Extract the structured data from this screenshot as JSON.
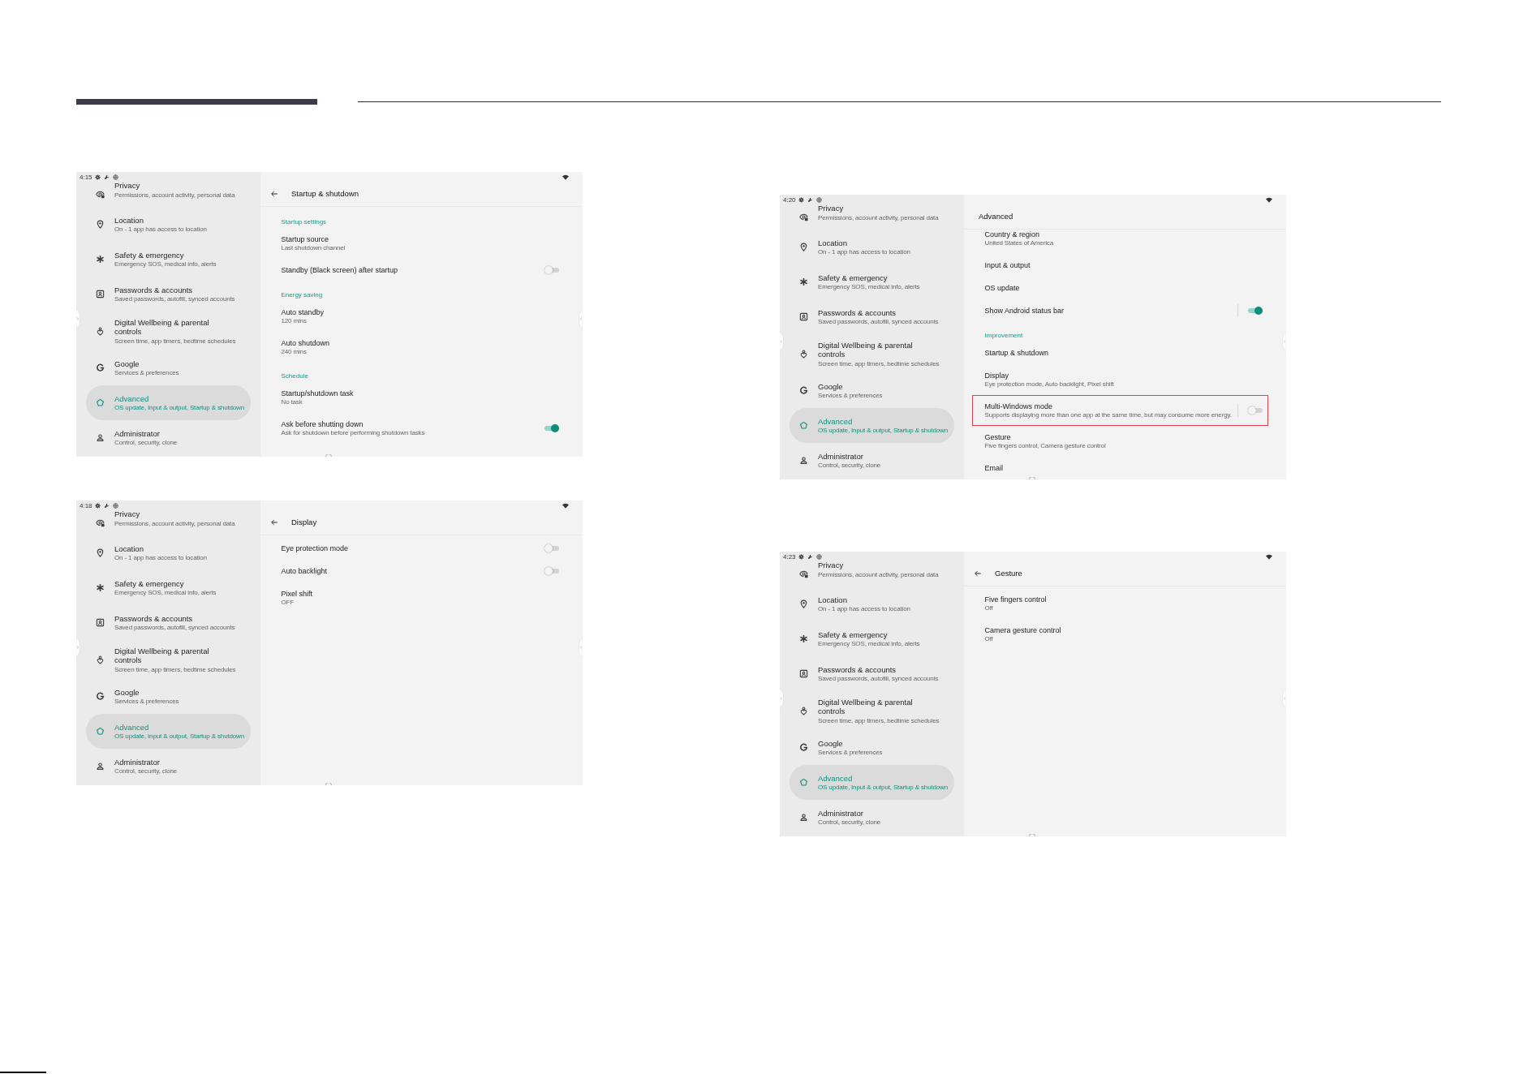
{
  "screens": [
    {
      "status_bar": {
        "time": "4:15"
      },
      "sidebar": {
        "items": [
          {
            "title": "Privacy",
            "subtitle": "Permissions, account activity, personal data",
            "selected": false
          },
          {
            "title": "Location",
            "subtitle": "On - 1 app has access to location",
            "selected": false
          },
          {
            "title": "Safety & emergency",
            "subtitle": "Emergency SOS, medical info, alerts",
            "selected": false
          },
          {
            "title": "Passwords & accounts",
            "subtitle": "Saved passwords, autofill, synced accounts",
            "selected": false
          },
          {
            "title": "Digital Wellbeing & parental controls",
            "subtitle": "Screen time, app timers, bedtime schedules",
            "selected": false
          },
          {
            "title": "Google",
            "subtitle": "Services & preferences",
            "selected": false
          },
          {
            "title": "Advanced",
            "subtitle": "OS update, Input & output, Startup & shutdown",
            "selected": true
          },
          {
            "title": "Administrator",
            "subtitle": "Control, security, clone",
            "selected": false
          }
        ]
      },
      "page": {
        "title": "Startup & shutdown",
        "back": true,
        "items": [
          {
            "kind": "section",
            "title": "Startup settings"
          },
          {
            "kind": "entry",
            "title": "Startup source",
            "subtitle": "Last shutdown channel"
          },
          {
            "kind": "switch",
            "title": "Standby (Black screen) after startup",
            "on": false
          },
          {
            "kind": "section",
            "title": "Energy saving"
          },
          {
            "kind": "entry",
            "title": "Auto standby",
            "subtitle": "120 mins"
          },
          {
            "kind": "entry",
            "title": "Auto shutdown",
            "subtitle": "240 mins"
          },
          {
            "kind": "section",
            "title": "Schedule"
          },
          {
            "kind": "entry",
            "title": "Startup/shutdown task",
            "subtitle": "No task"
          },
          {
            "kind": "switch",
            "title": "Ask before shutting down",
            "subtitle": "Ask for shutdown before performing shutdown tasks",
            "on": true
          }
        ]
      }
    },
    {
      "status_bar": {
        "time": "4:18"
      },
      "sidebar": {
        "items": [
          {
            "title": "Privacy",
            "subtitle": "Permissions, account activity, personal data",
            "selected": false
          },
          {
            "title": "Location",
            "subtitle": "On - 1 app has access to location",
            "selected": false
          },
          {
            "title": "Safety & emergency",
            "subtitle": "Emergency SOS, medical info, alerts",
            "selected": false
          },
          {
            "title": "Passwords & accounts",
            "subtitle": "Saved passwords, autofill, synced accounts",
            "selected": false
          },
          {
            "title": "Digital Wellbeing & parental controls",
            "subtitle": "Screen time, app timers, bedtime schedules",
            "selected": false
          },
          {
            "title": "Google",
            "subtitle": "Services & preferences",
            "selected": false
          },
          {
            "title": "Advanced",
            "subtitle": "OS update, Input & output, Startup & shutdown",
            "selected": true
          },
          {
            "title": "Administrator",
            "subtitle": "Control, security, clone",
            "selected": false
          }
        ]
      },
      "page": {
        "title": "Display",
        "back": true,
        "items": [
          {
            "kind": "switch",
            "title": "Eye protection mode",
            "on": false
          },
          {
            "kind": "switch",
            "title": "Auto backlight",
            "on": false
          },
          {
            "kind": "entry",
            "title": "Pixel shift",
            "subtitle": "OFF"
          }
        ]
      }
    },
    {
      "status_bar": {
        "time": "4:20"
      },
      "sidebar": {
        "items": [
          {
            "title": "Privacy",
            "subtitle": "Permissions, account activity, personal data",
            "selected": false
          },
          {
            "title": "Location",
            "subtitle": "On - 1 app has access to location",
            "selected": false
          },
          {
            "title": "Safety & emergency",
            "subtitle": "Emergency SOS, medical info, alerts",
            "selected": false
          },
          {
            "title": "Passwords & accounts",
            "subtitle": "Saved passwords, autofill, synced accounts",
            "selected": false
          },
          {
            "title": "Digital Wellbeing & parental controls",
            "subtitle": "Screen time, app timers, bedtime schedules",
            "selected": false
          },
          {
            "title": "Google",
            "subtitle": "Services & preferences",
            "selected": false
          },
          {
            "title": "Advanced",
            "subtitle": "OS update, Input & output, Startup & shutdown",
            "selected": true
          },
          {
            "title": "Administrator",
            "subtitle": "Control, security, clone",
            "selected": false
          }
        ]
      },
      "page": {
        "title": "Advanced",
        "back": false,
        "items": [
          {
            "kind": "entry",
            "title": "Country & region",
            "subtitle": "United States of America",
            "highlighted": false
          },
          {
            "kind": "entry",
            "title": "Input & output",
            "highlighted": false
          },
          {
            "kind": "entry",
            "title": "OS update",
            "highlighted": false
          },
          {
            "kind": "split",
            "title": "Show Android status bar",
            "on": true,
            "highlighted": false
          },
          {
            "kind": "section",
            "title": "Improvement",
            "highlighted": false
          },
          {
            "kind": "entry",
            "title": "Startup & shutdown",
            "highlighted": false
          },
          {
            "kind": "entry",
            "title": "Display",
            "subtitle": "Eye protection mode, Auto backlight, Pixel shift",
            "highlighted": false
          },
          {
            "kind": "split",
            "title": "Multi-Windows mode",
            "subtitle": "Supports displaying more than one app at the same time, but may consume more energy.",
            "on": false,
            "highlighted": true
          },
          {
            "kind": "entry",
            "title": "Gesture",
            "subtitle": "Five fingers control, Camera gesture control",
            "highlighted": false
          },
          {
            "kind": "entry",
            "title": "Email",
            "highlighted": false
          }
        ]
      }
    },
    {
      "status_bar": {
        "time": "4:23"
      },
      "sidebar": {
        "items": [
          {
            "title": "Privacy",
            "subtitle": "Permissions, account activity, personal data",
            "selected": false
          },
          {
            "title": "Location",
            "subtitle": "On - 1 app has access to location",
            "selected": false
          },
          {
            "title": "Safety & emergency",
            "subtitle": "Emergency SOS, medical info, alerts",
            "selected": false
          },
          {
            "title": "Passwords & accounts",
            "subtitle": "Saved passwords, autofill, synced accounts",
            "selected": false
          },
          {
            "title": "Digital Wellbeing & parental controls",
            "subtitle": "Screen time, app timers, bedtime schedules",
            "selected": false
          },
          {
            "title": "Google",
            "subtitle": "Services & preferences",
            "selected": false
          },
          {
            "title": "Advanced",
            "subtitle": "OS update, Input & output, Startup & shutdown",
            "selected": true
          },
          {
            "title": "Administrator",
            "subtitle": "Control, security, clone",
            "selected": false
          }
        ]
      },
      "page": {
        "title": "Gesture",
        "back": true,
        "items": [
          {
            "kind": "entry",
            "title": "Five fingers control",
            "subtitle": "Off"
          },
          {
            "kind": "entry",
            "title": "Camera gesture control",
            "subtitle": "Off"
          }
        ]
      }
    }
  ]
}
